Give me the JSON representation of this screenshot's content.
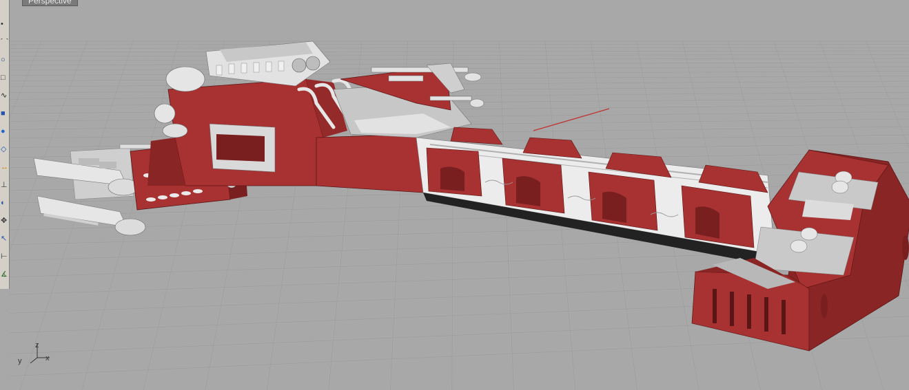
{
  "viewport": {
    "tab_label": "Perspective",
    "axis_labels": {
      "x": "x",
      "y": "y",
      "z": "z"
    }
  },
  "toolbar": {
    "tools": [
      {
        "name": "point-tool-icon"
      },
      {
        "name": "curve-tool-icon"
      },
      {
        "name": "circle-tool-icon"
      },
      {
        "name": "rectangle-tool-icon"
      },
      {
        "name": "polyline-tool-icon"
      },
      {
        "name": "box-solid-icon"
      },
      {
        "name": "sphere-solid-icon"
      },
      {
        "name": "surface-tool-icon"
      },
      {
        "name": "transform-tool-icon"
      },
      {
        "name": "dimension-tool-icon"
      },
      {
        "name": "render-tool-icon"
      },
      {
        "name": "pan-tool-icon"
      },
      {
        "name": "select-tool-icon"
      },
      {
        "name": "measure-tool-icon"
      },
      {
        "name": "analyze-tool-icon"
      }
    ]
  },
  "colors": {
    "background": "#a8a8a8",
    "grid_line": "#9a9a9a",
    "hull_red": "#a83232",
    "hull_dark": "#7a1f1f",
    "metal_light": "#e8e8e8",
    "metal_mid": "#bdbdbd"
  }
}
